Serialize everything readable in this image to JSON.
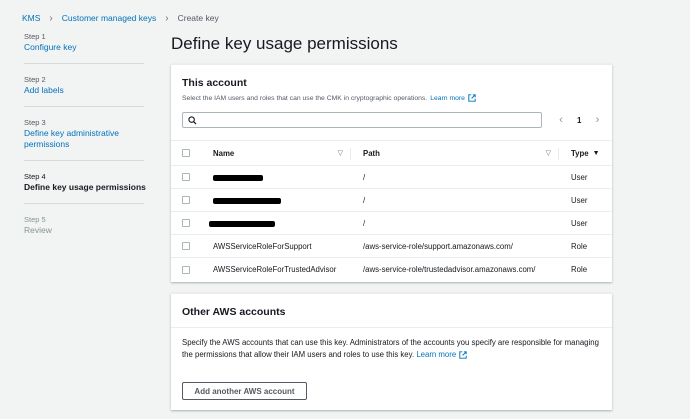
{
  "breadcrumb": {
    "items": [
      "KMS",
      "Customer managed keys"
    ],
    "current": "Create key"
  },
  "steps": [
    {
      "num": "Step 1",
      "label": "Configure key",
      "state": "done"
    },
    {
      "num": "Step 2",
      "label": "Add labels",
      "state": "done"
    },
    {
      "num": "Step 3",
      "label": "Define key administrative permissions",
      "state": "done"
    },
    {
      "num": "Step 4",
      "label": "Define key usage permissions",
      "state": "active"
    },
    {
      "num": "Step 5",
      "label": "Review",
      "state": "disabled"
    }
  ],
  "page_title": "Define key usage permissions",
  "this_account": {
    "title": "This account",
    "description": "Select the IAM users and roles that can use the CMK in cryptographic operations.",
    "learn_more": "Learn more",
    "search_placeholder": "",
    "page_number": "1",
    "columns": {
      "name": "Name",
      "path": "Path",
      "type": "Type"
    },
    "rows": [
      {
        "name": "",
        "path": "/",
        "type": "User",
        "redacted": true
      },
      {
        "name": "",
        "path": "/",
        "type": "User",
        "redacted": true
      },
      {
        "name": "",
        "path": "/",
        "type": "User",
        "redacted": true
      },
      {
        "name": "AWSServiceRoleForSupport",
        "path": "/aws-service-role/support.amazonaws.com/",
        "type": "Role",
        "redacted": false
      },
      {
        "name": "AWSServiceRoleForTrustedAdvisor",
        "path": "/aws-service-role/trustedadvisor.amazonaws.com/",
        "type": "Role",
        "redacted": false
      }
    ]
  },
  "other_accounts": {
    "title": "Other AWS accounts",
    "description": "Specify the AWS accounts that can use this key. Administrators of the accounts you specify are responsible for managing the permissions that allow their IAM users and roles to use this key.",
    "learn_more": "Learn more",
    "add_button": "Add another AWS account"
  },
  "colors": {
    "link": "#0073bb",
    "background": "#f2f3f3",
    "text": "#16191f"
  }
}
